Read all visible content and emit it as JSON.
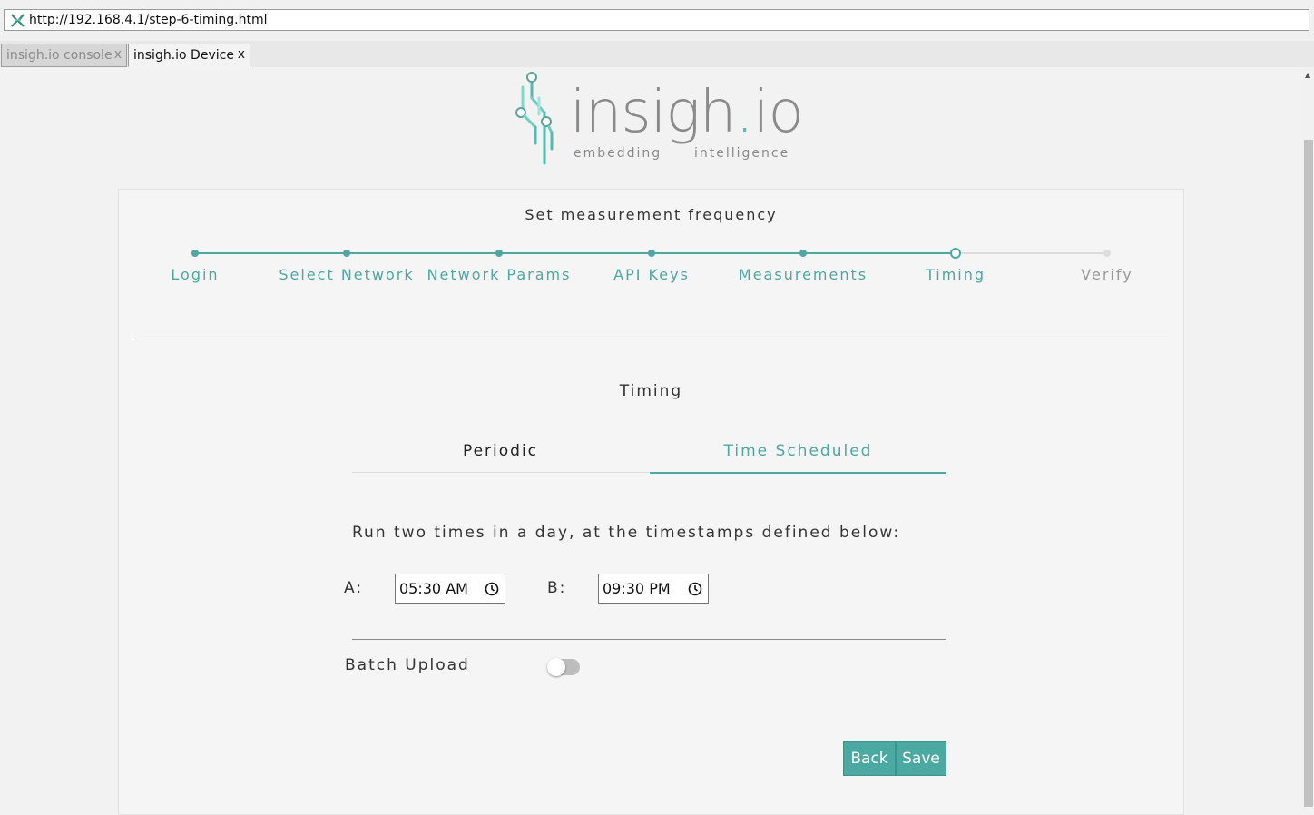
{
  "browser": {
    "url": "http://192.168.4.1/step-6-timing.html",
    "tabs": [
      {
        "label": "insigh.io console",
        "close": "x"
      },
      {
        "label": "insigh.io Device",
        "close": "x"
      }
    ]
  },
  "logo": {
    "name": "insigh",
    "dot": ".",
    "suffix": "io",
    "tagline_left": "embedding",
    "tagline_right": "intelligence"
  },
  "card": {
    "title": "Set measurement frequency",
    "steps": [
      {
        "label": "Login",
        "state": "done"
      },
      {
        "label": "Select Network",
        "state": "done"
      },
      {
        "label": "Network Params",
        "state": "done"
      },
      {
        "label": "API Keys",
        "state": "done"
      },
      {
        "label": "Measurements",
        "state": "done"
      },
      {
        "label": "Timing",
        "state": "current"
      },
      {
        "label": "Verify",
        "state": "pending"
      }
    ]
  },
  "timing": {
    "title": "Timing",
    "tabs": {
      "periodic": "Periodic",
      "scheduled": "Time Scheduled"
    },
    "active_tab": "Time Scheduled",
    "description": "Run two times in a day, at the timestamps defined below:",
    "a_label": "A:",
    "a_value": "05:30 AM",
    "b_label": "B:",
    "b_value": "09:30 PM",
    "batch_label": "Batch Upload",
    "batch_enabled": false,
    "back_label": "Back",
    "save_label": "Save"
  },
  "colors": {
    "accent": "#4aa9a0",
    "pending": "#dedede"
  }
}
